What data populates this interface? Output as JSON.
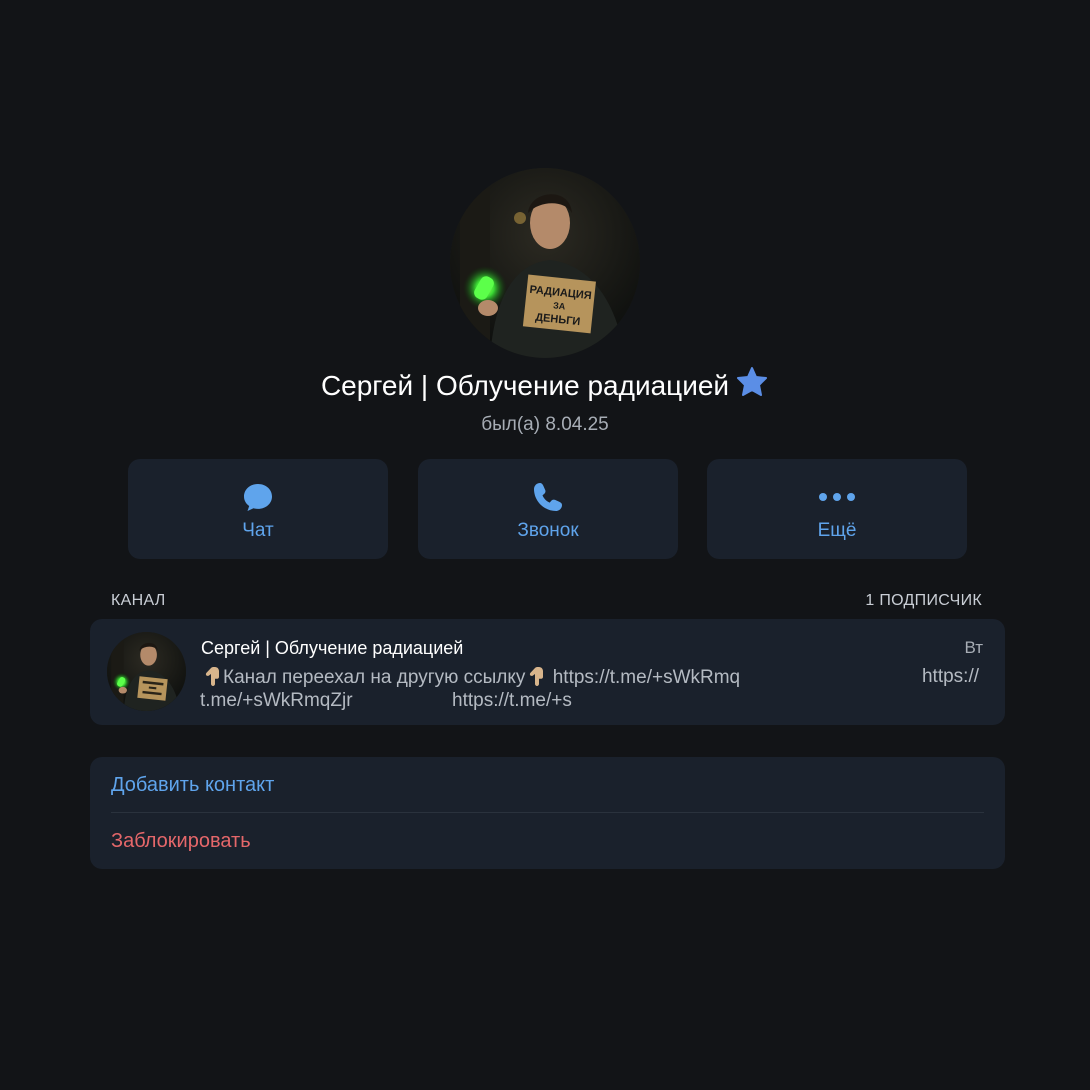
{
  "profile": {
    "name": "Сергей | Облучение радиацией",
    "status": "был(а) 8.04.25",
    "avatar_sign_text": [
      "РАДИАЦИЯ",
      "ЗА",
      "ДЕНЬГИ"
    ],
    "premium_icon": "star-badge-icon"
  },
  "actions": [
    {
      "label": "Чат",
      "icon": "chat-bubble-icon"
    },
    {
      "label": "Звонок",
      "icon": "phone-icon"
    },
    {
      "label": "Ещё",
      "icon": "more-dots-icon"
    }
  ],
  "section": {
    "title": "КАНАЛ",
    "count": "1 ПОДПИСЧИК"
  },
  "channel": {
    "name": "Сергей | Облучение радиацией",
    "date": "Вт",
    "preview_line1_text": "Канал переехал на другую ссылку",
    "preview_line1_link": "https://t.me/+sWkRmq",
    "preview_line1_link2": "https://",
    "preview_line2_link": "t.me/+sWkRmqZjr",
    "preview_line2_link2": "https://t.me/+s",
    "emoji_icon": "pointing-down-hand-icon"
  },
  "options": {
    "add_contact": "Добавить контакт",
    "block": "Заблокировать"
  },
  "colors": {
    "background": "#121417",
    "card": "#1a212c",
    "accent": "#5fa4ec",
    "danger": "#e5676a",
    "muted": "#a7adb5",
    "star": "#5b8ee6"
  }
}
